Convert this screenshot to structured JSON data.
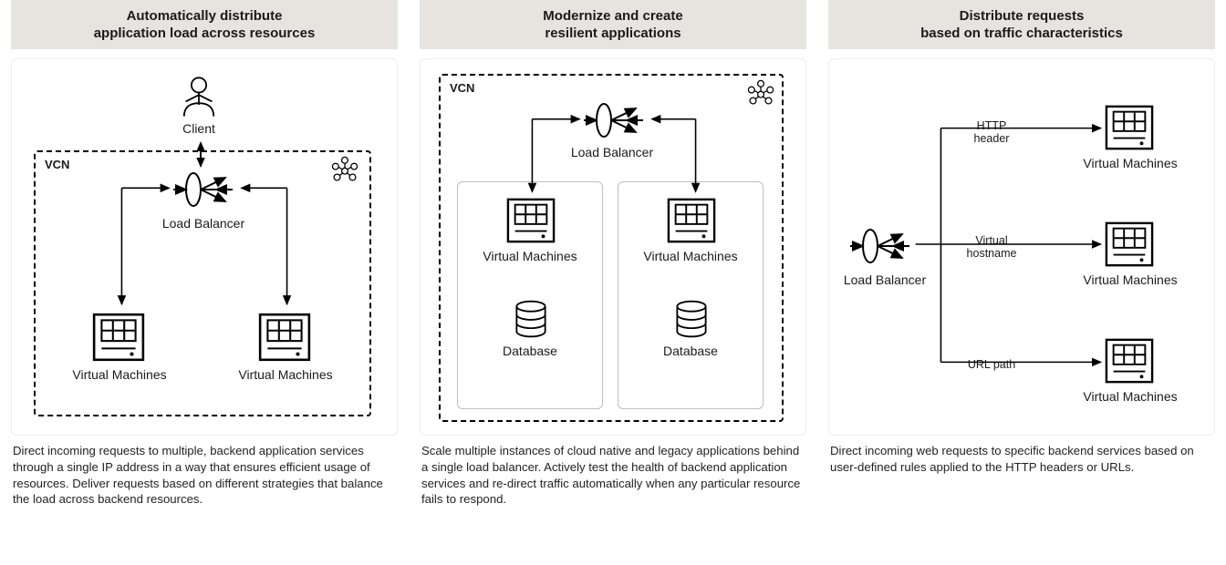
{
  "cards": [
    {
      "title": "Automatically distribute\napplication load across resources",
      "desc": "Direct incoming requests to multiple, backend application services  through a single IP address in a way that ensures efficient usage of  resources. Deliver requests based on different strategies that balance the load across backend resources.",
      "labels": {
        "client": "Client",
        "vcn": "VCN",
        "lb": "Load Balancer",
        "vm1": "Virtual Machines",
        "vm2": "Virtual Machines"
      }
    },
    {
      "title": "Modernize and create\nresilient applications",
      "desc": "Scale multiple instances of cloud native and legacy applications  behind a single load balancer. Actively test the health of backend  application services and re-direct traffic automatically when any  particular resource fails to respond.",
      "labels": {
        "vcn": "VCN",
        "lb": "Load Balancer",
        "vm1": "Virtual Machines",
        "vm2": "Virtual Machines",
        "db1": "Database",
        "db2": "Database"
      }
    },
    {
      "title": "Distribute requests\nbased on traffic characteristics",
      "desc": "Direct incoming web requests to specific backend services based on user-defined rules applied to the HTTP headers or URLs.",
      "labels": {
        "lb": "Load Balancer",
        "rule1": "HTTP\nheader",
        "rule2": "Virtual\nhostname",
        "rule3": "URL path",
        "vm1": "Virtual Machines",
        "vm2": "Virtual Machines",
        "vm3": "Virtual Machines"
      }
    }
  ]
}
